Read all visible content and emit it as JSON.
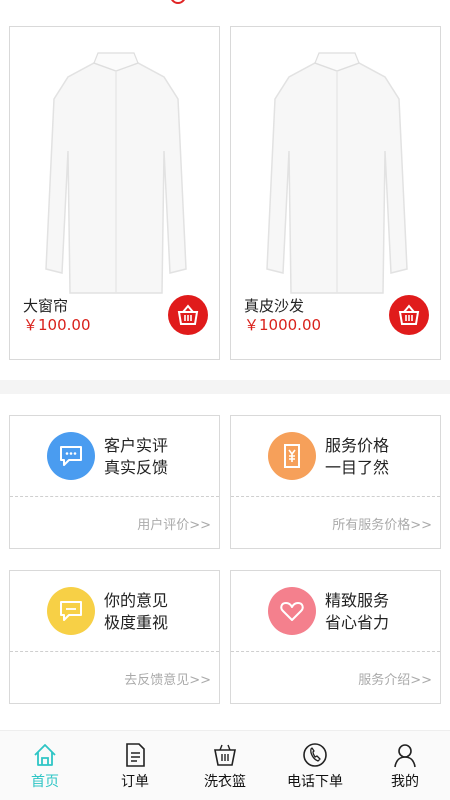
{
  "products": [
    {
      "name": "大窗帘",
      "price": "￥100.00"
    },
    {
      "name": "真皮沙发",
      "price": "￥1000.00"
    }
  ],
  "cards": [
    {
      "line1": "客户实评",
      "line2": "真实反馈",
      "link": "用户评价>>",
      "icon": "comment-icon",
      "color": "#4a9cf0"
    },
    {
      "line1": "服务价格",
      "line2": "一目了然",
      "link": "所有服务价格>>",
      "icon": "price-tag-icon",
      "color": "#f6a05a"
    },
    {
      "line1": "你的意见",
      "line2": "极度重视",
      "link": "去反馈意见>>",
      "icon": "feedback-icon",
      "color": "#f7d046"
    },
    {
      "line1": "精致服务",
      "line2": "省心省力",
      "link": "服务介绍>>",
      "icon": "heart-icon",
      "color": "#f4808d"
    }
  ],
  "tabbar": [
    {
      "label": "首页",
      "icon": "home-icon"
    },
    {
      "label": "订单",
      "icon": "order-icon"
    },
    {
      "label": "洗衣篮",
      "icon": "basket-icon"
    },
    {
      "label": "电话下单",
      "icon": "phone-icon"
    },
    {
      "label": "我的",
      "icon": "profile-icon"
    }
  ],
  "colors": {
    "accent": "#2fc5c5",
    "price": "#d9221c",
    "cart_button": "#e01b1b"
  }
}
